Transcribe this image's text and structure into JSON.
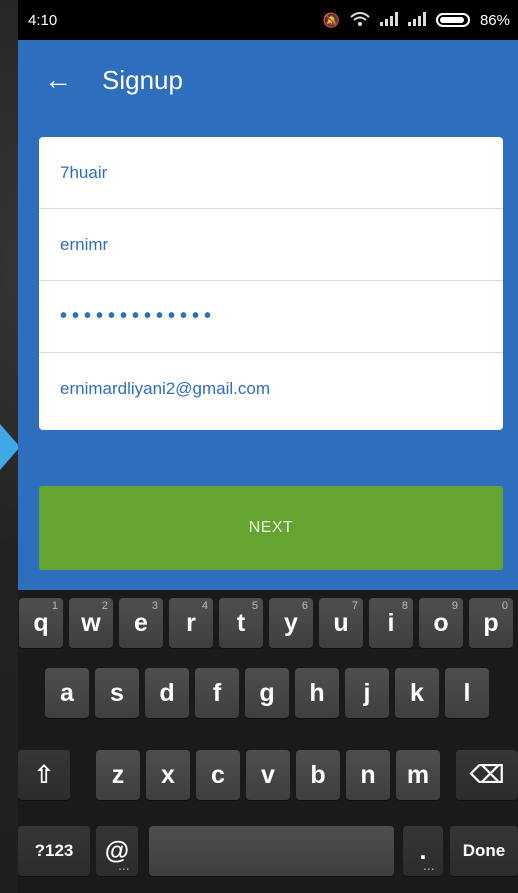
{
  "status": {
    "time": "4:10",
    "battery": "86%"
  },
  "appbar": {
    "back_icon": "←",
    "title": "Signup"
  },
  "form": {
    "fields": [
      {
        "value": "7huair"
      },
      {
        "value": "ernimr"
      },
      {
        "value": "•••••••••••••"
      },
      {
        "value": "ernimardliyani2@gmail.com"
      }
    ],
    "next_label": "NEXT"
  },
  "keyboard": {
    "row1": [
      {
        "k": "q",
        "h": "1"
      },
      {
        "k": "w",
        "h": "2"
      },
      {
        "k": "e",
        "h": "3"
      },
      {
        "k": "r",
        "h": "4"
      },
      {
        "k": "t",
        "h": "5"
      },
      {
        "k": "y",
        "h": "6"
      },
      {
        "k": "u",
        "h": "7"
      },
      {
        "k": "i",
        "h": "8"
      },
      {
        "k": "o",
        "h": "9"
      },
      {
        "k": "p",
        "h": "0"
      }
    ],
    "row2": [
      "a",
      "s",
      "d",
      "f",
      "g",
      "h",
      "j",
      "k",
      "l"
    ],
    "row3": [
      "z",
      "x",
      "c",
      "v",
      "b",
      "n",
      "m"
    ],
    "shift": "⇧",
    "backspace": "⌫",
    "symbols": "?123",
    "at": "@",
    "period": ".",
    "done": "Done"
  },
  "icons": {
    "mute": "bell-off-icon",
    "wifi": "wifi-icon",
    "signal": "signal-icon",
    "battery": "battery-icon"
  }
}
